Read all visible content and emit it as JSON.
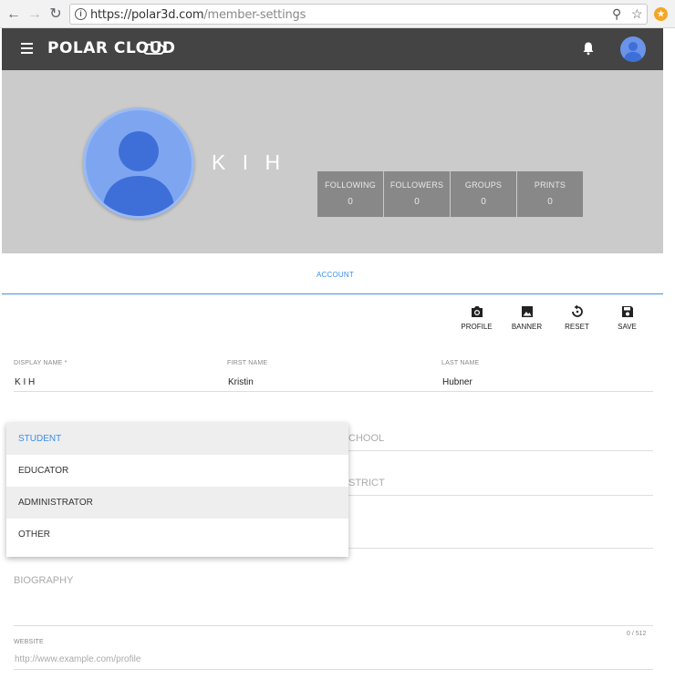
{
  "browser": {
    "url_scheme": "https://polar3d.com",
    "url_path": "/member-settings"
  },
  "header": {
    "logo": "POLAR CLOUD"
  },
  "profile": {
    "display_name": "K I H",
    "stats": [
      {
        "label": "FOLLOWING",
        "value": "0"
      },
      {
        "label": "FOLLOWERS",
        "value": "0"
      },
      {
        "label": "GROUPS",
        "value": "0"
      },
      {
        "label": "PRINTS",
        "value": "0"
      }
    ]
  },
  "tabs": {
    "account": "ACCOUNT"
  },
  "actions": {
    "profile": "PROFILE",
    "banner": "BANNER",
    "reset": "RESET",
    "save": "SAVE"
  },
  "form": {
    "display_name_label": "DISPLAY NAME *",
    "display_name_value": "K I H",
    "first_name_label": "FIRST NAME",
    "first_name_value": "Kristin",
    "last_name_label": "LAST NAME",
    "last_name_value": "Hubner",
    "school_label": "CHOOL",
    "district_label": "STRICT",
    "biography_label": "BIOGRAPHY",
    "biography_counter": "0 / 512",
    "website_label": "WEBSITE",
    "website_placeholder": "http://www.example.com/profile"
  },
  "role_dropdown": {
    "options": [
      "STUDENT",
      "EDUCATOR",
      "ADMINISTRATOR",
      "OTHER"
    ],
    "selected": "STUDENT"
  },
  "colors": {
    "header_bg": "#444444",
    "banner_bg": "#cbcbcb",
    "accent": "#3a8ee6",
    "stat_bg": "#888888"
  }
}
